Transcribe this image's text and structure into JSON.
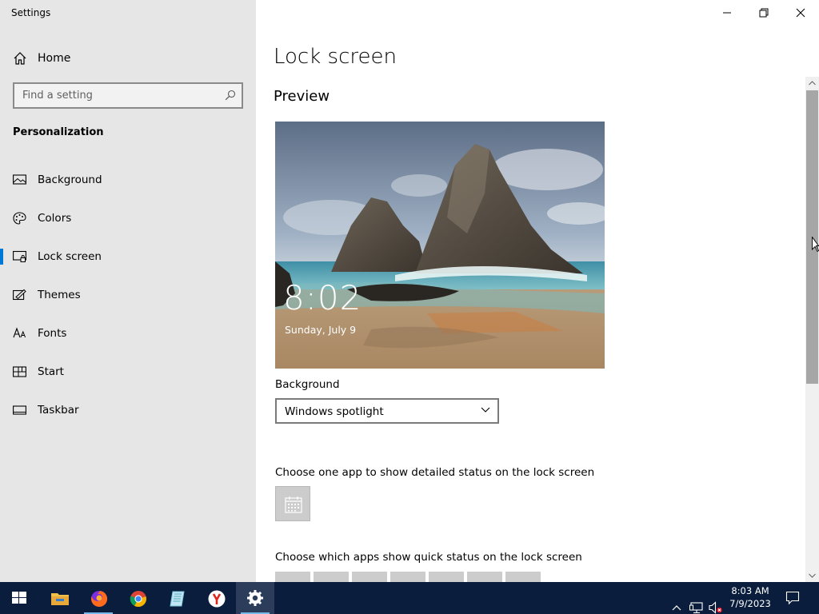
{
  "window": {
    "title": "Settings"
  },
  "sidebar": {
    "home_label": "Home",
    "search_placeholder": "Find a setting",
    "section_title": "Personalization",
    "items": [
      {
        "label": "Background",
        "icon": "picture-icon"
      },
      {
        "label": "Colors",
        "icon": "palette-icon"
      },
      {
        "label": "Lock screen",
        "icon": "lock-screen-icon",
        "active": true
      },
      {
        "label": "Themes",
        "icon": "themes-icon"
      },
      {
        "label": "Fonts",
        "icon": "fonts-icon"
      },
      {
        "label": "Start",
        "icon": "start-icon"
      },
      {
        "label": "Taskbar",
        "icon": "taskbar-icon"
      }
    ]
  },
  "main": {
    "title": "Lock screen",
    "preview_heading": "Preview",
    "preview_time": "8:02",
    "preview_date": "Sunday, July 9",
    "background_label": "Background",
    "background_value": "Windows spotlight",
    "detailed_status_label": "Choose one app to show detailed status on the lock screen",
    "quick_status_label": "Choose which apps show quick status on the lock screen"
  },
  "taskbar": {
    "apps": [
      "start-icon",
      "file-explorer-icon",
      "firefox-icon",
      "chrome-icon",
      "notepad-icon",
      "yandex-icon",
      "settings-icon"
    ],
    "time": "8:03 AM",
    "date": "7/9/2023"
  },
  "colors": {
    "accent": "#0078d7",
    "sidebar_bg": "#e6e6e6",
    "taskbar_bg": "#0a1d3d"
  }
}
